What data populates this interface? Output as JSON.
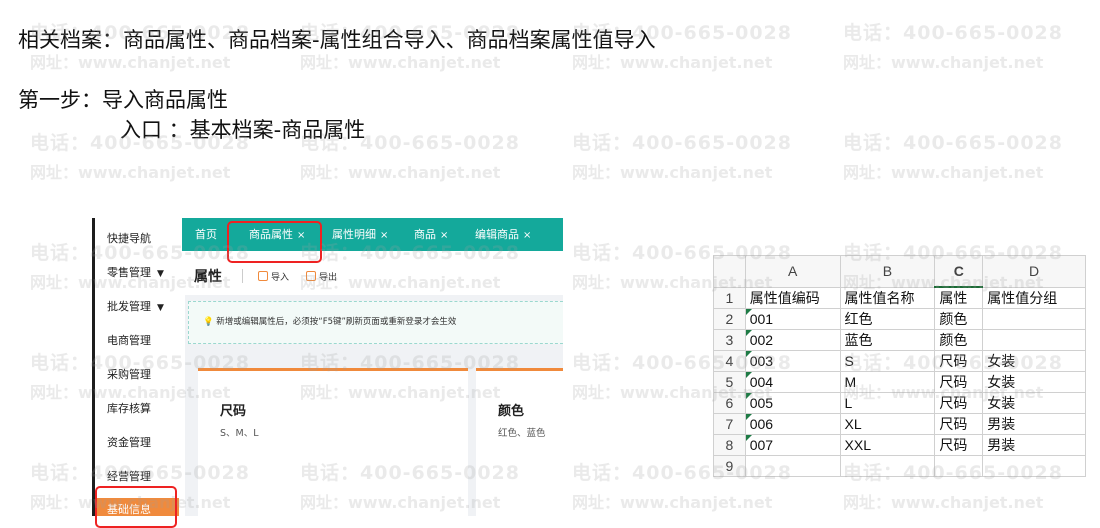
{
  "doc": {
    "line1": "相关档案：商品属性、商品档案-属性组合导入、商品档案属性值导入",
    "line2": "第一步：导入商品属性",
    "line3": "入口 ：基本档案-商品属性"
  },
  "erp": {
    "sidebar": [
      {
        "label": "快捷导航",
        "caret": ""
      },
      {
        "label": "零售管理",
        "caret": "▼"
      },
      {
        "label": "批发管理",
        "caret": "▼"
      },
      {
        "label": "电商管理",
        "caret": ""
      },
      {
        "label": "采购管理",
        "caret": ""
      },
      {
        "label": "库存核算",
        "caret": ""
      },
      {
        "label": "资金管理",
        "caret": ""
      },
      {
        "label": "经营管理",
        "caret": ""
      },
      {
        "label": "基础信息",
        "caret": ""
      }
    ],
    "tabs": [
      {
        "label": "首页",
        "close": ""
      },
      {
        "label": "商品属性",
        "close": "×"
      },
      {
        "label": "属性明细",
        "close": "×"
      },
      {
        "label": "商品",
        "close": "×"
      },
      {
        "label": "编辑商品",
        "close": "×"
      }
    ],
    "page_title": "属性",
    "import_label": "导入",
    "export_label": "导出",
    "notice": "新增或编辑属性后，必须按“F5键”刷新页面或重新登录才会生效",
    "cards": [
      {
        "title": "尺码",
        "values": "S、M、L"
      },
      {
        "title": "颜色",
        "values": "红色、蓝色"
      }
    ],
    "accent_color": "#14a99b",
    "highlight_color": "#f08a3c"
  },
  "sheet": {
    "columns": [
      "A",
      "B",
      "C",
      "D"
    ],
    "rows": [
      {
        "n": "1",
        "cells": [
          "属性值编码",
          "属性值名称",
          "属性",
          "属性值分组"
        ]
      },
      {
        "n": "2",
        "cells": [
          "001",
          "红色",
          "颜色",
          ""
        ]
      },
      {
        "n": "3",
        "cells": [
          "002",
          "蓝色",
          "颜色",
          ""
        ]
      },
      {
        "n": "4",
        "cells": [
          "003",
          "S",
          "尺码",
          "女装"
        ]
      },
      {
        "n": "5",
        "cells": [
          "004",
          "M",
          "尺码",
          "女装"
        ]
      },
      {
        "n": "6",
        "cells": [
          "005",
          "L",
          "尺码",
          "女装"
        ]
      },
      {
        "n": "7",
        "cells": [
          "006",
          "XL",
          "尺码",
          "男装"
        ]
      },
      {
        "n": "8",
        "cells": [
          "007",
          "XXL",
          "尺码",
          "男装"
        ]
      },
      {
        "n": "9",
        "cells": [
          "",
          "",
          "",
          ""
        ]
      }
    ]
  },
  "watermark": {
    "phone": "电话：400-665-0028",
    "site": "网址：www.chanjet.net"
  }
}
